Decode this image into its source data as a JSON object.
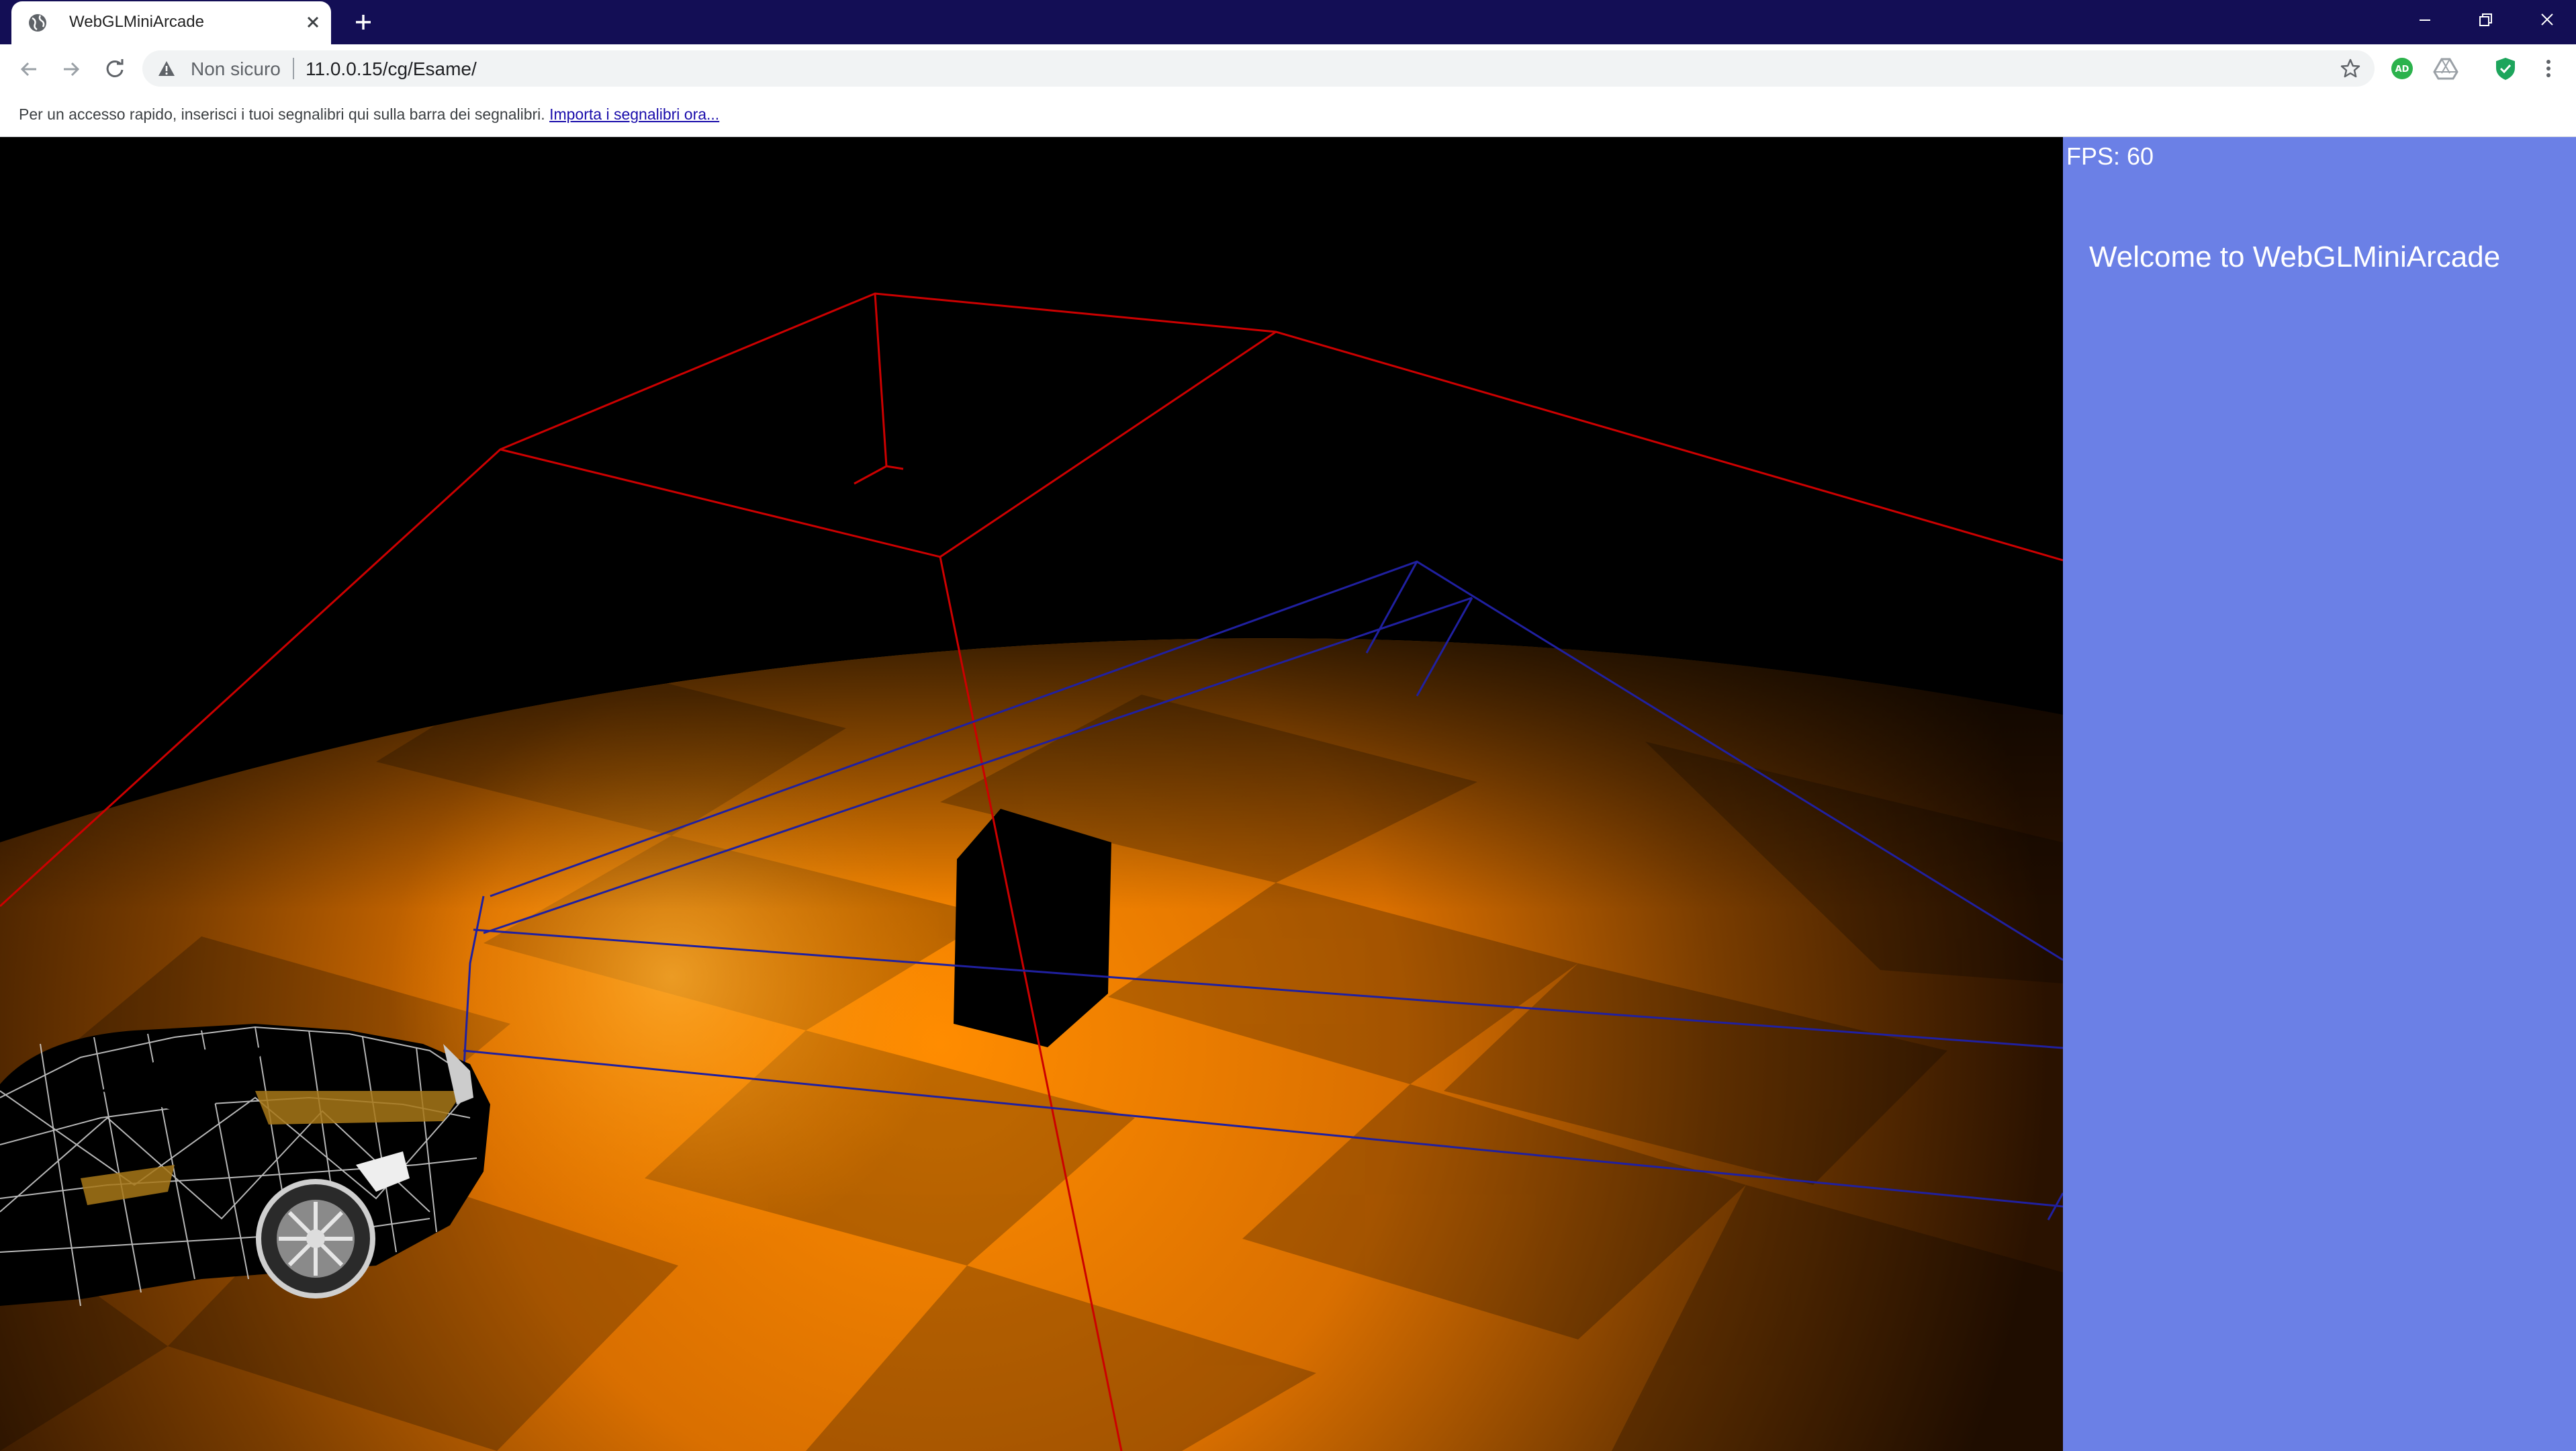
{
  "browser": {
    "tab": {
      "title": "WebGLMiniArcade"
    },
    "address": {
      "security_label": "Non sicuro",
      "url": "11.0.0.15/cg/Esame/"
    },
    "bookmarks_bar": {
      "message": "Per un accesso rapido, inserisci i tuoi segnalibri qui sulla barra dei segnalibri.",
      "import_link": "Importa i segnalibri ora..."
    },
    "extensions": [
      {
        "icon": "adguard-icon",
        "badge": "AD",
        "color": "#2bb24c"
      },
      {
        "icon": "drive-icon",
        "color": "#9aa0a6"
      },
      {
        "icon": "shield-check-icon",
        "color": "#1da55c"
      }
    ]
  },
  "app": {
    "fps_label": "FPS: 60",
    "welcome_title": "Welcome to WebGLMiniArcade",
    "panel_color": "#6b80e6",
    "floor_color": "#ff8a00",
    "wire_colors": {
      "arena": "#cc0000",
      "path": "#2020a0"
    }
  }
}
